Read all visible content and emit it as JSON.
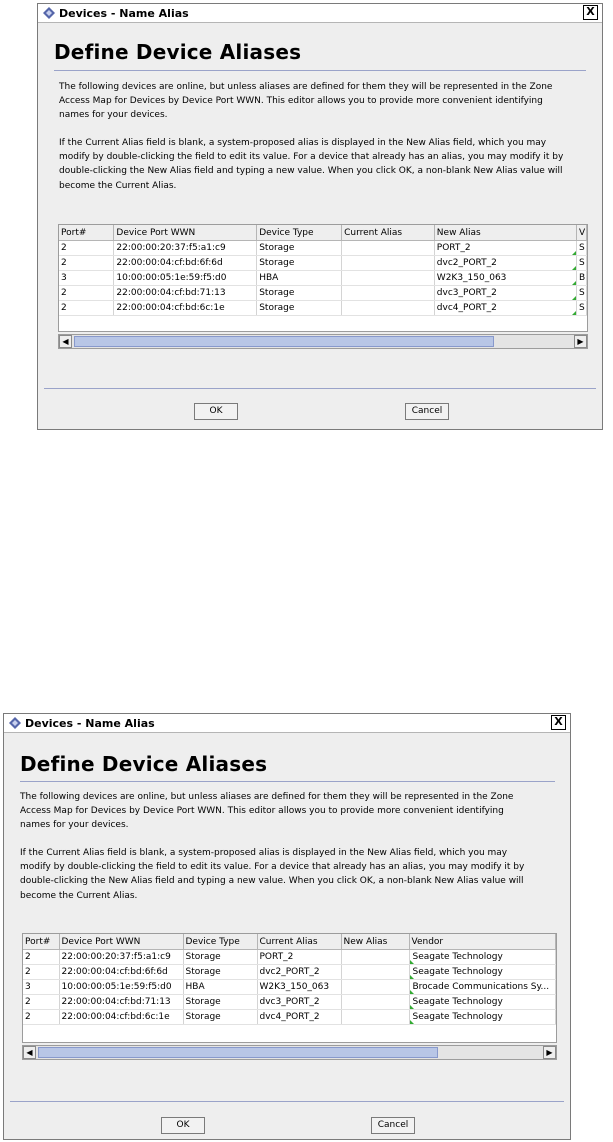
{
  "dialogs": [
    {
      "window_title": "Devices - Name Alias",
      "close_glyph": "X",
      "heading": "Define Device Aliases",
      "intro_lines": [
        "The following devices are online, but unless aliases are defined for them they will be represented in the Zone",
        "Access Map for Devices by Device Port WWN. This editor allows you to provide more convenient identifying",
        "names for your devices."
      ],
      "detail_lines": [
        "If the Current Alias field is blank, a system-proposed alias is displayed in the New Alias field, which you may",
        "modify by double-clicking the field to edit its value. For a device that already has an alias, you may modify it by",
        "double-clicking the New Alias field and typing a new value. When you click OK, a non-blank New Alias value will",
        "become the Current Alias."
      ],
      "table": {
        "columns": [
          "Port#",
          "Device Port WWN",
          "Device Type",
          "Current Alias",
          "New Alias",
          "V"
        ],
        "rows": [
          {
            "port": "2",
            "wwn": "22:00:00:20:37:f5:a1:c9",
            "type": "Storage",
            "current_alias": "",
            "new_alias": "PORT_2",
            "vendor": "S"
          },
          {
            "port": "2",
            "wwn": "22:00:00:04:cf:bd:6f:6d",
            "type": "Storage",
            "current_alias": "",
            "new_alias": "dvc2_PORT_2",
            "vendor": "S"
          },
          {
            "port": "3",
            "wwn": "10:00:00:05:1e:59:f5:d0",
            "type": "HBA",
            "current_alias": "",
            "new_alias": "W2K3_150_063",
            "vendor": "B"
          },
          {
            "port": "2",
            "wwn": "22:00:00:04:cf:bd:71:13",
            "type": "Storage",
            "current_alias": "",
            "new_alias": "dvc3_PORT_2",
            "vendor": "S"
          },
          {
            "port": "2",
            "wwn": "22:00:00:04:cf:bd:6c:1e",
            "type": "Storage",
            "current_alias": "",
            "new_alias": "dvc4_PORT_2",
            "vendor": "S"
          }
        ]
      },
      "scroll_left": "◀",
      "scroll_right": "▶",
      "ok_label": "OK",
      "cancel_label": "Cancel"
    },
    {
      "window_title": "Devices - Name Alias",
      "close_glyph": "X",
      "heading": "Define Device Aliases",
      "intro_lines": [
        "The following devices are online, but unless aliases are defined for them they will be represented in the Zone",
        "Access Map for Devices by Device Port WWN. This editor allows you to provide more convenient identifying",
        "names for your devices."
      ],
      "detail_lines": [
        "If the Current Alias field is blank, a system-proposed alias is displayed in the New Alias field, which you may",
        "modify by double-clicking the field to edit its value. For a device that already has an alias, you may modify it by",
        "double-clicking the New Alias field and typing a new value. When you click OK, a non-blank New Alias value will",
        "become the Current Alias."
      ],
      "table": {
        "columns": [
          "Port#",
          "Device Port WWN",
          "Device Type",
          "Current Alias",
          "New Alias",
          "Vendor"
        ],
        "rows": [
          {
            "port": "2",
            "wwn": "22:00:00:20:37:f5:a1:c9",
            "type": "Storage",
            "current_alias": "PORT_2",
            "new_alias": "",
            "vendor": "Seagate Technology"
          },
          {
            "port": "2",
            "wwn": "22:00:00:04:cf:bd:6f:6d",
            "type": "Storage",
            "current_alias": "dvc2_PORT_2",
            "new_alias": "",
            "vendor": "Seagate Technology"
          },
          {
            "port": "3",
            "wwn": "10:00:00:05:1e:59:f5:d0",
            "type": "HBA",
            "current_alias": "W2K3_150_063",
            "new_alias": "",
            "vendor": "Brocade Communications Sy..."
          },
          {
            "port": "2",
            "wwn": "22:00:00:04:cf:bd:71:13",
            "type": "Storage",
            "current_alias": "dvc3_PORT_2",
            "new_alias": "",
            "vendor": "Seagate Technology"
          },
          {
            "port": "2",
            "wwn": "22:00:00:04:cf:bd:6c:1e",
            "type": "Storage",
            "current_alias": "dvc4_PORT_2",
            "new_alias": "",
            "vendor": "Seagate Technology"
          }
        ]
      },
      "scroll_left": "◀",
      "scroll_right": "▶",
      "ok_label": "OK",
      "cancel_label": "Cancel"
    }
  ]
}
